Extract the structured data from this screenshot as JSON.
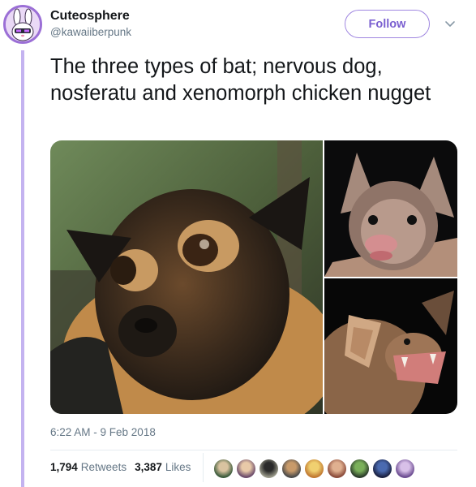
{
  "author": {
    "display_name": "Cuteosphere",
    "handle": "@kawaiiberpunk",
    "avatar_icon": "bunny-avatar-icon"
  },
  "follow_label": "Follow",
  "menu_icon": "chevron-down-icon",
  "tweet": {
    "text": "The three types of bat; nervous dog, nosferatu and xenomorph chicken nugget",
    "timestamp": "6:22 AM - 9 Feb 2018"
  },
  "stats": {
    "retweets_count": "1,794",
    "retweets_label": "Retweets",
    "likes_count": "3,387",
    "likes_label": "Likes"
  },
  "likers_count_shown": 9,
  "colors": {
    "accent": "#9f86e0",
    "thread_line": "#c4b3f0",
    "muted_text": "#657786"
  }
}
